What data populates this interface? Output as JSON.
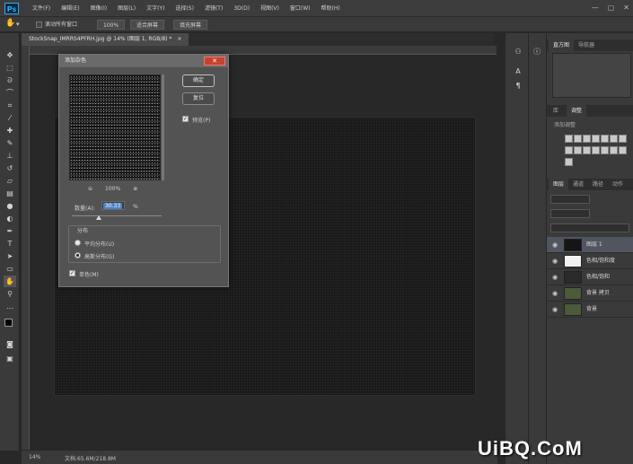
{
  "app": {
    "logo": "Ps",
    "menus": [
      "文件(F)",
      "编辑(E)",
      "图像(I)",
      "图层(L)",
      "文字(Y)",
      "选择(S)",
      "滤镜(T)",
      "3D(D)",
      "视图(V)",
      "窗口(W)",
      "帮助(H)"
    ],
    "window_controls": [
      "—",
      "▢",
      "✕"
    ]
  },
  "options": {
    "scroll_all_label": "滚动所有窗口",
    "zoom": "100%",
    "fit_screen": "适合屏幕",
    "fill_screen": "填充屏幕"
  },
  "document": {
    "tab_title": "StockSnap_IMRRS4PFRH.jpg @ 14% (图层 1, RGB/8) *",
    "tab_close": "×"
  },
  "status": {
    "zoom": "14%",
    "doc_info": "文档:65.6M/218.8M"
  },
  "dialog": {
    "title": "添加杂色",
    "close": "✕",
    "ok": "确定",
    "reset": "复位",
    "preview_label": "预览(P)",
    "preview_checked": true,
    "zoom_out": "⊖",
    "zoom_level": "100%",
    "zoom_in": "⊕",
    "amount_label": "数量(A):",
    "amount_value": "30.33",
    "amount_unit": "%",
    "amount_slider_fraction": 0.3,
    "distribution_label": "分布",
    "uniform_label": "平均分布(U)",
    "gaussian_label": "高斯分布(G)",
    "selected_distribution": "gaussian",
    "monochromatic_label": "单色(M)",
    "monochromatic_checked": true
  },
  "panels": {
    "top_tabs": [
      "直方图",
      "导航器"
    ],
    "adjust_tabs": [
      "库",
      "调整"
    ],
    "adjust_title": "添加调整",
    "layers_tabs": [
      "图层",
      "通道",
      "路径",
      "动作"
    ],
    "layers": [
      {
        "name": "图层 1",
        "selected": true,
        "thumb": "#151515"
      },
      {
        "name": "色相/饱和度",
        "selected": false,
        "thumb": "#f2f2f2"
      },
      {
        "name": "色相/饱和",
        "selected": false,
        "thumb": "#2a2a2a"
      },
      {
        "name": "背景 拷贝",
        "selected": false,
        "thumb": "#4a5a3a"
      },
      {
        "name": "背景",
        "selected": false,
        "thumb": "#4a5a3a"
      }
    ]
  },
  "watermark": "UiBQ.CoM"
}
